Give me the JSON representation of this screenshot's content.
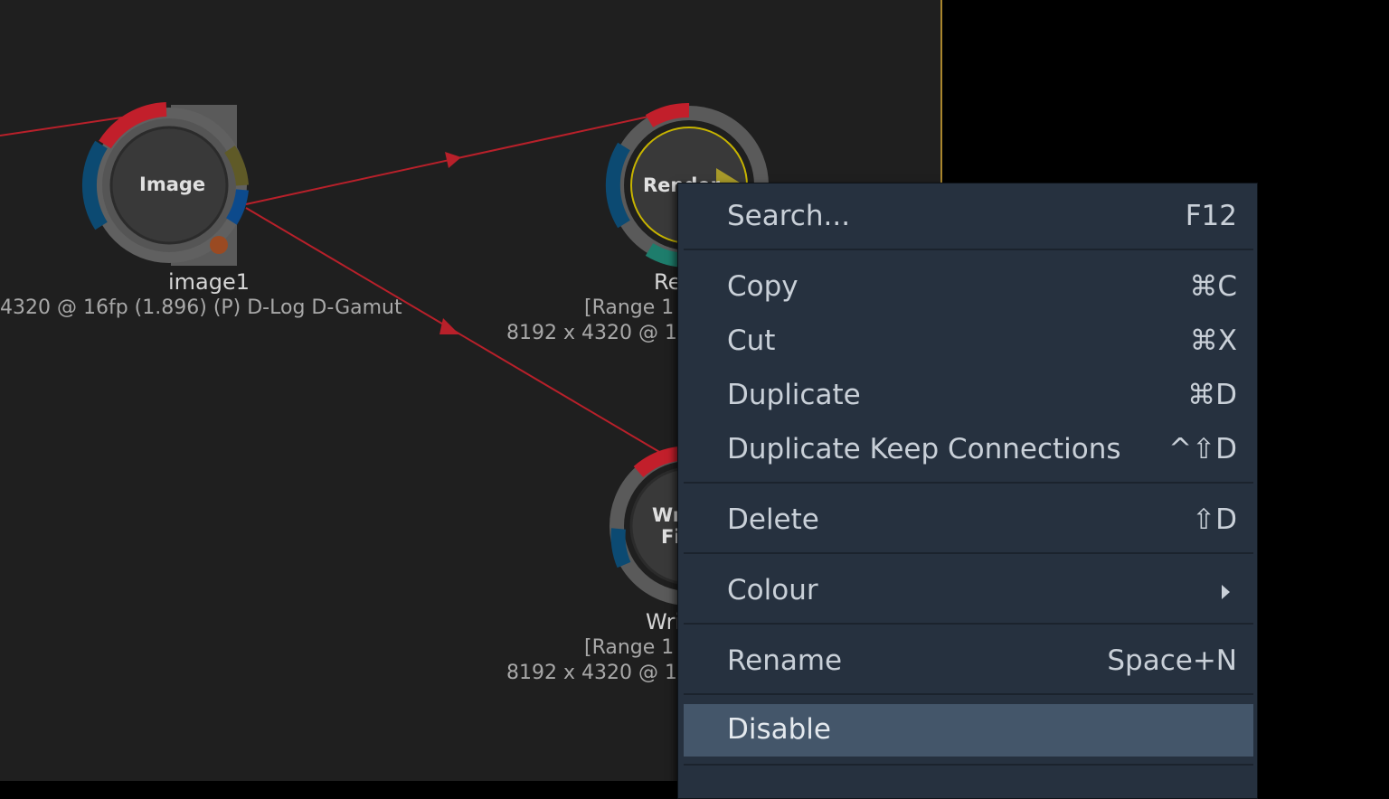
{
  "graph": {
    "nodes": [
      {
        "id": "image",
        "title": "Image",
        "label": "image1",
        "info": "4320 @ 16fp (1.896) (P) D-Log D-Gamut"
      },
      {
        "id": "render",
        "title": "Render",
        "label": "Re",
        "info_line1": "[Range  1",
        "info_line2": "8192 x 4320 @ 1"
      },
      {
        "id": "write",
        "title_line1": "Wr",
        "title_line2": "Fi",
        "label": "Wri",
        "info_line1": "[Range  1",
        "info_line2": "8192 x 4320 @ 1"
      }
    ]
  },
  "context_menu": {
    "items": [
      {
        "label": "Search...",
        "shortcut": "F12"
      },
      {
        "label": "Copy",
        "shortcut": "⌘C"
      },
      {
        "label": "Cut",
        "shortcut": "⌘X"
      },
      {
        "label": "Duplicate",
        "shortcut": "⌘D"
      },
      {
        "label": "Duplicate Keep Connections",
        "shortcut": "^⇧D"
      },
      {
        "label": "Delete",
        "shortcut": "⇧D"
      },
      {
        "label": "Colour",
        "submenu": true
      },
      {
        "label": "Rename",
        "shortcut": "Space+N"
      },
      {
        "label": "Disable",
        "highlighted": true
      }
    ]
  },
  "colors": {
    "graph_bg": "#1f1f1f",
    "edge": "#b8202a",
    "menu_bg": "#26313f",
    "menu_highlight": "#44566a",
    "divider": "#a9852c"
  }
}
